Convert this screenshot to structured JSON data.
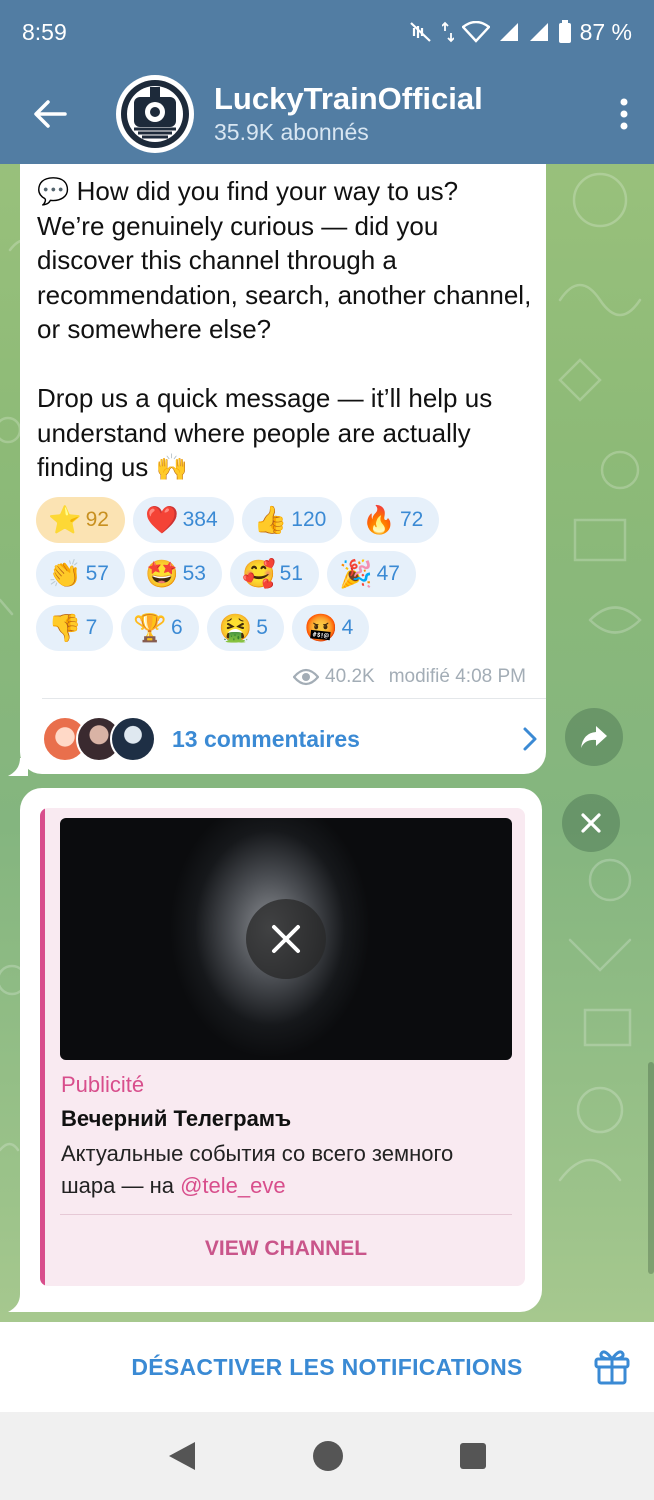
{
  "status_bar": {
    "time": "8:59",
    "battery": "87 %"
  },
  "header": {
    "title": "LuckyTrainOfficial",
    "subtitle": "35.9K abonnés"
  },
  "post": {
    "text": "💬 How did you find your way to us? We’re genuinely curious — did you discover this channel through a recommendation, search, another channel, or somewhere else?\n\nDrop us a quick message — it’ll help us understand where people are actually finding us 🙌",
    "reactions": [
      [
        {
          "emoji": "⭐",
          "count": "92",
          "active": true
        },
        {
          "emoji": "❤️",
          "count": "384"
        },
        {
          "emoji": "👍",
          "count": "120"
        },
        {
          "emoji": "🔥",
          "count": "72"
        }
      ],
      [
        {
          "emoji": "👏",
          "count": "57"
        },
        {
          "emoji": "🤩",
          "count": "53"
        },
        {
          "emoji": "🥰",
          "count": "51"
        },
        {
          "emoji": "🎉",
          "count": "47"
        }
      ],
      [
        {
          "emoji": "👎",
          "count": "7"
        },
        {
          "emoji": "🏆",
          "count": "6"
        },
        {
          "emoji": "🤮",
          "count": "5"
        },
        {
          "emoji": "🤬",
          "count": "4"
        }
      ]
    ],
    "views": "40.2K",
    "edited_time": "modifié 4:08 PM",
    "comments_label": "13 commentaires"
  },
  "ad": {
    "label": "Publicité",
    "title": "Вечерний Телеграмъ",
    "description": "Актуальные события со всего земного шара — на ",
    "handle": "@tele_eve",
    "cta": "VIEW CHANNEL"
  },
  "bottom": {
    "mute_label": "DÉSACTIVER LES NOTIFICATIONS"
  },
  "colors": {
    "header_bg": "#527da3",
    "accent_blue": "#3b8ad4",
    "ad_pink": "#d84e8c",
    "active_reaction_bg": "#fbe3b3"
  },
  "icons": {
    "back": "arrow-left-icon",
    "menu": "kebab-menu-icon",
    "share": "share-arrow-icon",
    "close": "close-icon",
    "views": "eye-icon",
    "chevron": "chevron-right-icon",
    "gift": "gift-icon"
  }
}
